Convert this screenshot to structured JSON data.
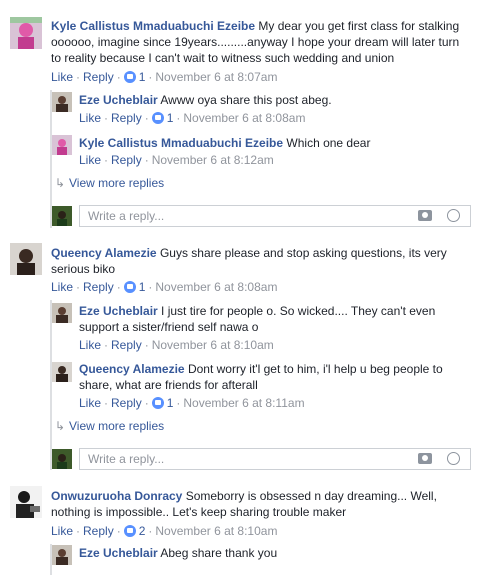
{
  "comments": [
    {
      "author": "Kyle Callistus Mmaduabuchi Ezeibe",
      "text": "My dear you get first class for stalking oooooo, imagine since 19years.........anyway I hope your dream will later turn to reality because I can't wait to witness such wedding and union",
      "like": "Like",
      "reply": "Reply",
      "likes": "1",
      "time": "November 6 at 8:07am",
      "replies": [
        {
          "author": "Eze Ucheblair",
          "text": "Awww oya share this post abeg.",
          "like": "Like",
          "reply": "Reply",
          "likes": "1",
          "time": "November 6 at 8:08am"
        },
        {
          "author": "Kyle Callistus Mmaduabuchi Ezeibe",
          "text": "Which one dear",
          "like": "Like",
          "reply": "Reply",
          "likes": "",
          "time": "November 6 at 8:12am"
        }
      ],
      "view_more": "View more replies",
      "reply_placeholder": "Write a reply..."
    },
    {
      "author": "Queency Alamezie",
      "text": "Guys share please and stop asking questions, its very serious biko",
      "like": "Like",
      "reply": "Reply",
      "likes": "1",
      "time": "November 6 at 8:08am",
      "replies": [
        {
          "author": "Eze Ucheblair",
          "text": "I just tire for people o. So wicked.... They can't even support a sister/friend self nawa o",
          "like": "Like",
          "reply": "Reply",
          "likes": "",
          "time": "November 6 at 8:10am"
        },
        {
          "author": "Queency Alamezie",
          "text": "Dont worry it'l get to him, i'l help u beg people to share, what are friends for afterall",
          "like": "Like",
          "reply": "Reply",
          "likes": "1",
          "time": "November 6 at 8:11am"
        }
      ],
      "view_more": "View more replies",
      "reply_placeholder": "Write a reply..."
    },
    {
      "author": "Onwuzuruoha Donracy",
      "text": "Someborry is obsessed n day dreaming... Well, nothing is impossible.. Let's keep sharing trouble maker",
      "like": "Like",
      "reply": "Reply",
      "likes": "2",
      "time": "November 6 at 8:10am",
      "replies": [
        {
          "author": "Eze Ucheblair",
          "text": "Abeg share thank you",
          "like": "",
          "reply": "",
          "likes": "",
          "time": ""
        }
      ]
    }
  ]
}
